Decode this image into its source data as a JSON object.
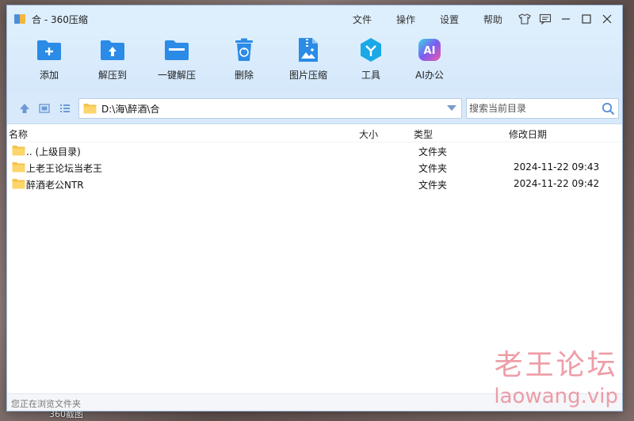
{
  "window": {
    "title": "合 - 360压缩"
  },
  "menu": [
    "文件",
    "操作",
    "设置",
    "帮助"
  ],
  "window_controls": [
    "shirt-icon",
    "message-icon",
    "minimize-icon",
    "maximize-icon",
    "close-icon"
  ],
  "toolbar": [
    {
      "label": "添加",
      "icon": "add-folder-icon"
    },
    {
      "label": "解压到",
      "icon": "extract-to-icon"
    },
    {
      "label": "一键解压",
      "icon": "one-click-extract-icon"
    },
    {
      "label": "删除",
      "icon": "delete-icon"
    },
    {
      "label": "图片压缩",
      "icon": "image-compress-icon"
    },
    {
      "label": "工具",
      "icon": "tools-icon"
    },
    {
      "label": "AI办公",
      "icon": "ai-office-icon"
    }
  ],
  "address": {
    "path": "D:\\海\\醉酒\\合"
  },
  "search": {
    "placeholder": "搜索当前目录"
  },
  "columns": {
    "name": "名称",
    "size": "大小",
    "type": "类型",
    "modified": "修改日期"
  },
  "files": [
    {
      "name": ".. (上级目录)",
      "type": "文件夹",
      "modified": ""
    },
    {
      "name": "上老王论坛当老王",
      "type": "文件夹",
      "modified": "2024-11-22 09:43"
    },
    {
      "name": "醉酒老公NTR",
      "type": "文件夹",
      "modified": "2024-11-22 09:42"
    }
  ],
  "status": "您正在浏览文件夹",
  "desktop_label": "360截图",
  "watermark": {
    "line1": "老王论坛",
    "line2": "laowang.vip"
  },
  "colors": {
    "accent": "#2b8be6",
    "titlebar": "#ddeefc",
    "folder": "#f5c24a"
  }
}
